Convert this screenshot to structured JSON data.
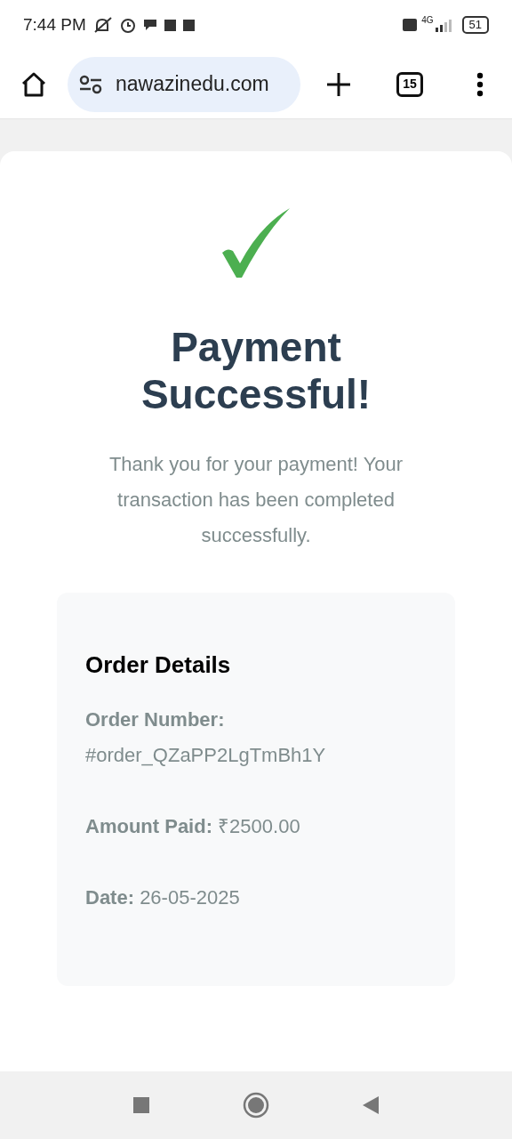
{
  "status_bar": {
    "time": "7:44 PM",
    "network": "4G",
    "battery": "51"
  },
  "browser": {
    "url": "nawazinedu.com",
    "tab_count": "15"
  },
  "title": "Payment Successful!",
  "message": "Thank you for your payment! Your transaction has been completed successfully.",
  "order_details": {
    "heading": "Order Details",
    "lines": [
      {
        "text": "**Order Number:** #order_QZaPP2LgTmBh1Y"
      },
      {
        "text": "**Amount Paid:** ₹2500.00"
      },
      {
        "text": "**Date:** 26-05-2025"
      }
    ]
  }
}
